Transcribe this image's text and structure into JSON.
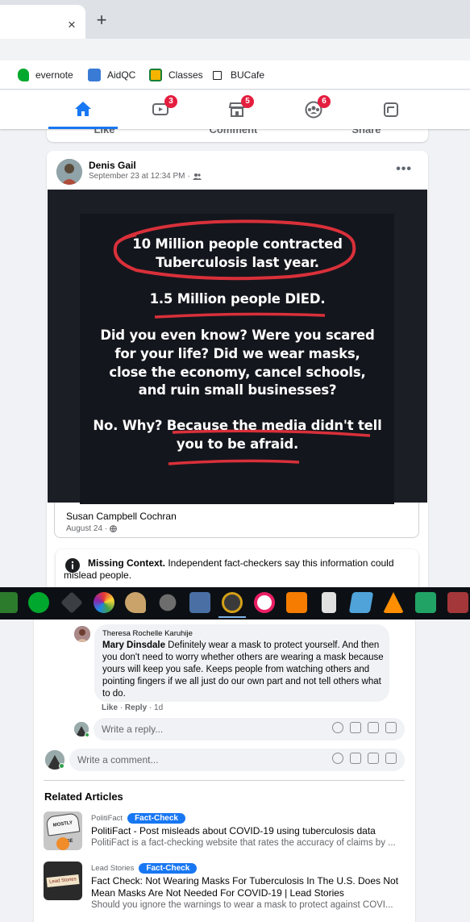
{
  "browser": {
    "tab_close": "×",
    "new_tab": "+",
    "bookmarks": [
      {
        "label": "evernote",
        "icon": "evernote-icon"
      },
      {
        "label": "AidQC",
        "icon": "aidqc-icon"
      },
      {
        "label": "Classes",
        "icon": "classes-icon"
      },
      {
        "label": "BUCafe",
        "icon": "page-icon"
      }
    ]
  },
  "fb_nav": {
    "items": [
      {
        "name": "home",
        "badge": ""
      },
      {
        "name": "watch",
        "badge": "3"
      },
      {
        "name": "marketplace",
        "badge": "5"
      },
      {
        "name": "groups",
        "badge": "6"
      },
      {
        "name": "gaming",
        "badge": ""
      }
    ],
    "accent": "#1877f2"
  },
  "previous_post": {
    "actions": [
      "Like",
      "Comment",
      "Share"
    ]
  },
  "post": {
    "author": "Denis Gail",
    "date": "September 23 at 12:34 PM",
    "audience_sep": "·",
    "menu": "•••",
    "image_text": {
      "line1": "10 Million people contracted",
      "line2": "Tuberculosis last year.",
      "line3": "1.5 Million people DIED.",
      "line4": "Did you even know? Were you scared",
      "line5": "for your life? Did we wear masks,",
      "line6": "close the economy, cancel schools,",
      "line7": "and ruin small businesses?",
      "line8": "No. Why? Because the media didn't tell",
      "line9": "you to be afraid."
    },
    "shared_author": "Susan Campbell Cochran",
    "shared_date": "August 24 ·",
    "fact_check": {
      "label": "Missing Context.",
      "text": " Independent fact-checkers say this information could",
      "text2": "mislead people."
    }
  },
  "comments": {
    "reply": {
      "name_label": "Theresa Rochelle Karuhije",
      "tagged": "Mary Dinsdale",
      "text": " Definitely wear a mask to protect yourself. And then you don't need to worry whether others are wearing a mask because yours will keep you safe. Keeps people from watching others and pointing fingers if we all just do our own part and not tell others what to do.",
      "like": "Like",
      "reply": "Reply",
      "time": "1d"
    },
    "reply_placeholder": "Write a reply...",
    "comment_placeholder": "Write a comment..."
  },
  "related": {
    "title": "Related Articles",
    "badge": "Fact-Check",
    "articles": [
      {
        "source": "PolitiFact",
        "title": "PolitiFact - Post misleads about COVID-19 using tuberculosis data",
        "desc": "PolitiFact is a fact-checking website that rates the accuracy of claims by ...",
        "thumb_text": "MOSTLY FALSE"
      },
      {
        "source": "Lead Stories",
        "title": "Fact Check: Not Wearing Masks For Tuberculosis In The U.S. Does Not Mean Masks Are Not Needed For COVID-19 | Lead Stories",
        "desc": "Should you ignore the warnings to wear a mask to protect against COVI...",
        "thumb_text": "Lead Stories"
      }
    ]
  }
}
